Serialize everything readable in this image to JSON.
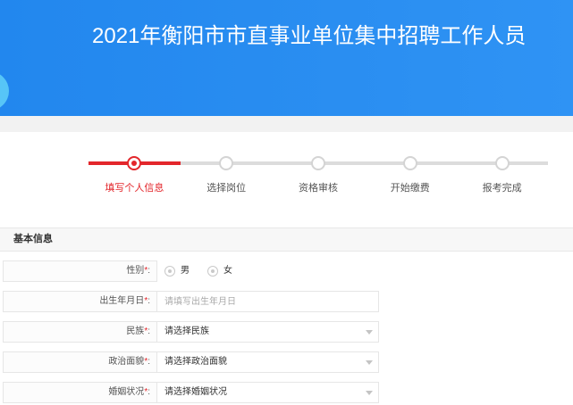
{
  "header": {
    "title": "2021年衡阳市市直事业单位集中招聘工作人员"
  },
  "progress": {
    "current_step": 1,
    "steps": [
      {
        "label": "填写个人信息"
      },
      {
        "label": "选择岗位"
      },
      {
        "label": "资格审核"
      },
      {
        "label": "开始缴费"
      },
      {
        "label": "报考完成"
      }
    ]
  },
  "section": {
    "title": "基本信息"
  },
  "form": {
    "required_mark": "*",
    "label_suffix": ":",
    "gender": {
      "label": "性别",
      "options": [
        "男",
        "女"
      ]
    },
    "birth_date": {
      "label": "出生年月日",
      "placeholder": "请填写出生年月日"
    },
    "ethnicity": {
      "label": "民族",
      "value": "请选择民族"
    },
    "political_status": {
      "label": "政治面貌",
      "value": "请选择政治面貌"
    },
    "marital_status": {
      "label": "婚姻状况",
      "value": "请选择婚姻状况"
    }
  },
  "colors": {
    "brand": "#2a8ef1",
    "brand-dark": "#2287ee",
    "accent": "#e3262b",
    "deco": "#57c5f7",
    "border": "#e6e6e6",
    "track": "#dcdcdc",
    "text": "#333333",
    "label": "#555555",
    "placeholder": "#aaaaaa"
  },
  "icons": {
    "step_marker": "step-circle-icon",
    "radio": "radio-icon",
    "dropdown": "chevron-down-icon"
  }
}
